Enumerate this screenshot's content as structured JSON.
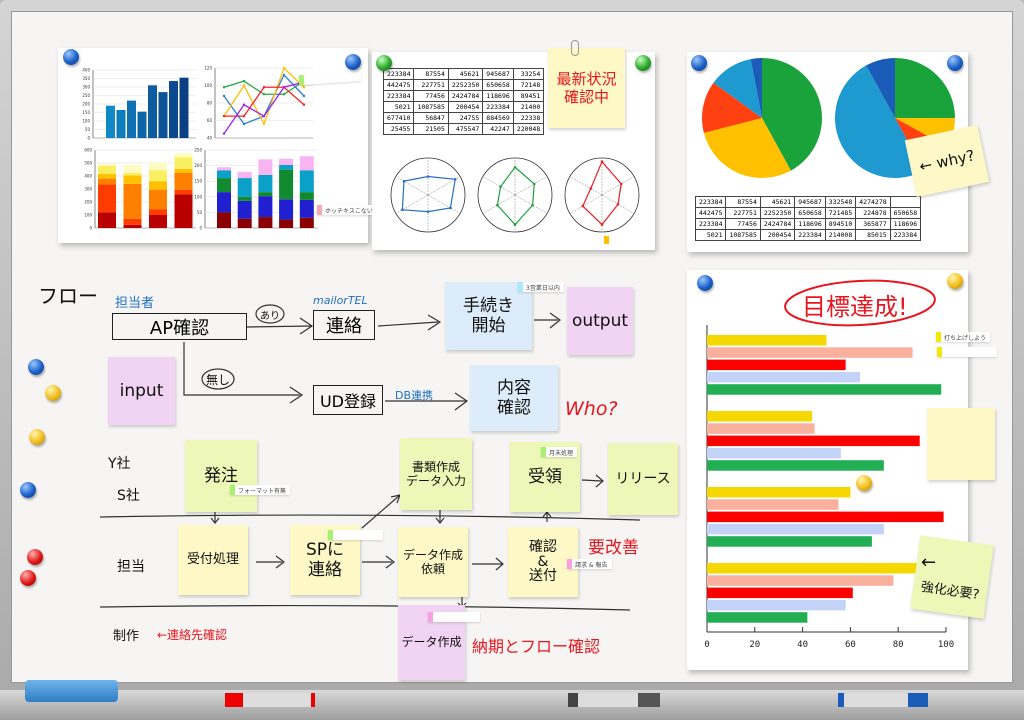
{
  "panel_top_left": {
    "bar_chart": {
      "type": "bar",
      "yticks": [
        "0",
        "50",
        "100",
        "150",
        "200",
        "250",
        "300",
        "350",
        "400"
      ],
      "ylim": [
        0,
        400
      ],
      "values": [
        190,
        165,
        220,
        155,
        310,
        270,
        335,
        355
      ]
    },
    "line_chart": {
      "type": "line",
      "yticks": [
        "40",
        "60",
        "80",
        "100",
        "120"
      ],
      "ylim": [
        40,
        120
      ],
      "series": [
        {
          "color": "#2aa84a",
          "values": [
            98,
            105,
            90,
            90,
            105
          ]
        },
        {
          "color": "#2a7fd4",
          "values": [
            88,
            56,
            65,
            112,
            88
          ]
        },
        {
          "color": "#ffc000",
          "values": [
            65,
            100,
            56,
            120,
            98
          ]
        },
        {
          "color": "#ff2020",
          "values": [
            65,
            65,
            98,
            98,
            78
          ]
        },
        {
          "color": "#a020f0",
          "values": [
            45,
            78,
            65,
            98,
            104
          ]
        }
      ]
    },
    "stacked_chart_1": {
      "type": "bar",
      "stacked": true,
      "yticks": [
        "0",
        "100",
        "200",
        "300",
        "400",
        "500",
        "600"
      ],
      "ylim": [
        0,
        600
      ],
      "colors": [
        "#b80000",
        "#ff3c00",
        "#ff8000",
        "#ffc000",
        "#f8f060",
        "#fdfbc0"
      ],
      "bars": [
        [
          120,
          215,
          45,
          35,
          65,
          10
        ],
        [
          25,
          45,
          270,
          65,
          20,
          60
        ],
        [
          100,
          45,
          150,
          65,
          85,
          60
        ],
        [
          260,
          35,
          130,
          30,
          90,
          30
        ]
      ]
    },
    "stacked_chart_2": {
      "type": "bar",
      "stacked": true,
      "yticks": [
        "0",
        "50",
        "100",
        "150",
        "200",
        "250"
      ],
      "ylim": [
        0,
        250
      ],
      "colors": [
        "#8b0000",
        "#2020d0",
        "#128a30",
        "#0aa0c8",
        "#f8b4f0"
      ],
      "bars": [
        [
          50,
          65,
          45,
          25,
          10
        ],
        [
          30,
          57,
          13,
          60,
          20
        ],
        [
          35,
          67,
          13,
          55,
          50
        ],
        [
          27,
          65,
          95,
          15,
          20
        ],
        [
          33,
          57,
          25,
          70,
          45
        ]
      ]
    },
    "tag_text": "ホッチキスこない"
  },
  "panel_top_middle": {
    "table": [
      [
        "223384",
        "87554",
        "45621",
        "945687",
        "33254"
      ],
      [
        "442475",
        "227751",
        "2252350",
        "650658",
        "72148"
      ],
      [
        "223384",
        "77456",
        "2424784",
        "118696",
        "89451"
      ],
      [
        "5021",
        "1087585",
        "200454",
        "223384",
        "21400"
      ],
      [
        "677410",
        "56847",
        "24755",
        "884569",
        "22338"
      ],
      [
        "25455",
        "21505",
        "475547",
        "42247",
        "220048"
      ]
    ],
    "sticky": "最新状況\n確認中",
    "radar_charts": [
      {
        "color": "#2a6fc0",
        "values": [
          0.5,
          0.85,
          0.7,
          0.45,
          0.8,
          0.75
        ]
      },
      {
        "color": "#22a040",
        "values": [
          0.75,
          0.6,
          0.55,
          0.8,
          0.55,
          0.45
        ]
      },
      {
        "color": "#e82020",
        "values": [
          0.9,
          0.6,
          0.5,
          0.8,
          0.6,
          0.35
        ]
      }
    ]
  },
  "panel_top_right": {
    "pie_left": {
      "type": "pie",
      "values": [
        42,
        29,
        14,
        12,
        3
      ],
      "colors": [
        "#1aa33a",
        "#ffc000",
        "#ff4010",
        "#1e9ad0",
        "#1a5cb8"
      ]
    },
    "pie_right": {
      "type": "pie",
      "values": [
        25,
        8,
        9,
        50,
        8
      ],
      "colors": [
        "#1aa33a",
        "#ffc000",
        "#ff4010",
        "#1e9ad0",
        "#1a5cb8"
      ]
    },
    "sticky": "← why?",
    "table": [
      [
        "223384",
        "87554",
        "45621",
        "945687",
        "332548",
        "4274278",
        ""
      ],
      [
        "442475",
        "227751",
        "2252350",
        "650658",
        "721485",
        "224878",
        "650658"
      ],
      [
        "223384",
        "77456",
        "2424784",
        "118696",
        "894510",
        "365877",
        "118696"
      ],
      [
        "5021",
        "1087585",
        "200454",
        "223384",
        "214008",
        "85015",
        "223384"
      ]
    ]
  },
  "panel_goal": {
    "title": "目標達成!",
    "tag1": "打ち上げしよう",
    "tag2": "",
    "sticky2": "強化必要?",
    "chart_data": {
      "type": "bar",
      "orientation": "horizontal",
      "xlim": [
        0,
        100
      ],
      "xticks": [
        "0",
        "20",
        "40",
        "60",
        "80",
        "100"
      ],
      "colors": [
        "#f5d800",
        "#f9b09c",
        "#ff0000",
        "#c2d3f7",
        "#22ae52"
      ],
      "groups": [
        [
          50,
          86,
          58,
          64,
          98
        ],
        [
          44,
          45,
          89,
          56,
          74
        ],
        [
          60,
          55,
          99,
          74,
          69
        ],
        [
          88,
          78,
          61,
          58,
          42
        ]
      ]
    }
  },
  "flow": {
    "title": "フロー",
    "owner_label": "担当者",
    "ap_check": "AP確認",
    "yes": "あり",
    "no": "無し",
    "mail_tel": "mailorTEL",
    "contact": "連絡",
    "procedure": "手続き\n開始",
    "procedure_tag": "3営業日以内",
    "output": "output",
    "input": "input",
    "ud_register": "UD登録",
    "db_link": "DB連携",
    "content_check": "内容\n確認",
    "who": "Who?",
    "y_company": "Y社",
    "s_company": "S社",
    "order": "発注",
    "order_tag": "フォーマット有無",
    "staff": "担当",
    "reception": "受付処理",
    "sp_contact": "SPに\n連絡",
    "docs": "書類作成\nデータ入力",
    "receipt": "受領",
    "receipt_tag": "月末処理",
    "release": "リリース",
    "data_request": "データ作成\n依頼",
    "confirm_send": "確認\n&\n送付",
    "confirm_tag": "請求 & 報告",
    "needs_improve": "要改善",
    "production": "制作",
    "contact_check": "←連絡先確認",
    "data_create": "データ作成",
    "deadline_check": "納期とフロー確認"
  }
}
